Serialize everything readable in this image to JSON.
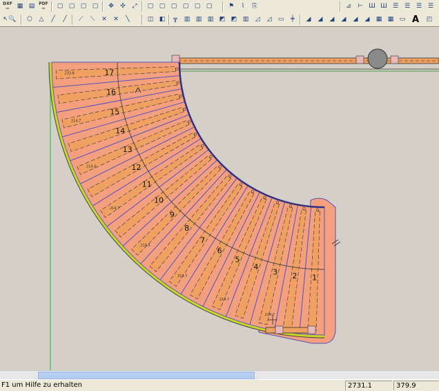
{
  "toolbar": {
    "dxf_label": "DXF",
    "pdf_label": "PDF",
    "text_tool_label": "A"
  },
  "drawing": {
    "step_numbers": [
      "1",
      "2",
      "3",
      "4",
      "5",
      "6",
      "7",
      "8",
      "9",
      "10",
      "11",
      "12",
      "13",
      "14",
      "15",
      "16",
      "17"
    ],
    "dims": [
      "233.8",
      "214.7",
      "214.0",
      "214.7",
      "214.4",
      "214.7",
      "214.7",
      "214.7"
    ]
  },
  "status": {
    "hint": "F1  um Hilfe zu erhalten",
    "coord_x": "2731.1",
    "coord_y": "379.9"
  },
  "colors": {
    "tread_fill": "#f4a07e",
    "stringer_fill": "#f0a060",
    "outer_edge": "#c8d820"
  }
}
